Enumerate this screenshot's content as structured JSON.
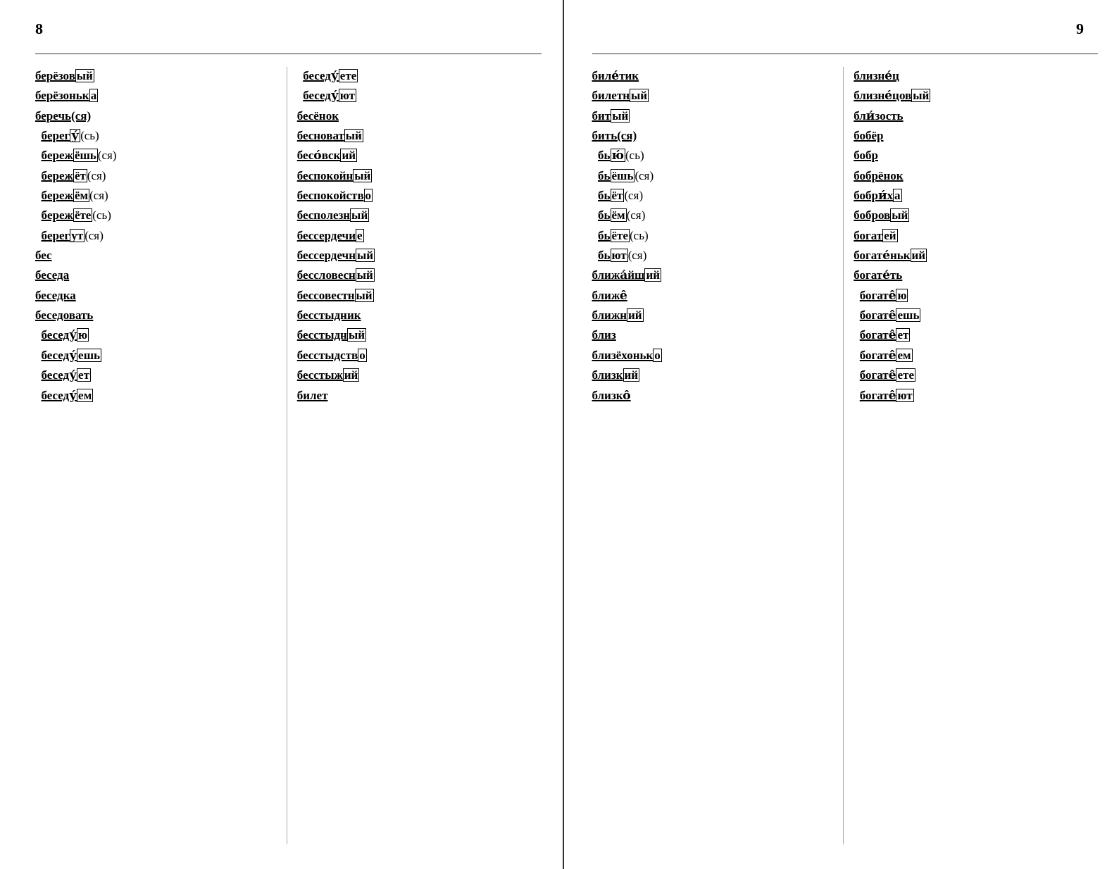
{
  "leftPage": {
    "number": "8",
    "col1": [
      {
        "html": "<span class='root'>берёзов</span><span class='box'>ый</span>"
      },
      {
        "html": "<span class='root'>берёзоньк</span><span class='box'>а</span>"
      },
      {
        "html": "<span class='root bold'>беречь(ся)</span>"
      },
      {
        "html": "&nbsp;&nbsp;<span class='root'>бeрег</span><span class='box'>у́</span>(сь)"
      },
      {
        "html": "&nbsp;&nbsp;<span class='root'>бeреж</span><span class='box'>ёшь</span>(ся)"
      },
      {
        "html": "&nbsp;&nbsp;<span class='root'>бeреж</span><span class='box'>ёт</span>(ся)"
      },
      {
        "html": "&nbsp;&nbsp;<span class='root'>бeреж</span><span class='box'>ём</span>(ся)"
      },
      {
        "html": "&nbsp;&nbsp;<span class='root'>бeреж</span><span class='box'>ёте</span>(сь)"
      },
      {
        "html": "&nbsp;&nbsp;<span class='root'>бeрег</span><span class='box'>ут</span>(ся)"
      },
      {
        "html": "<span class='root bold'>бес</span>"
      },
      {
        "html": "<span class='root bold'>беседа</span>"
      },
      {
        "html": "<span class='root bold'>беседка</span>"
      },
      {
        "html": "<span class='root bold'>беседовать</span>"
      },
      {
        "html": "&nbsp;&nbsp;<span class='root'>беседу́</span><span class='box'>ю</span>"
      },
      {
        "html": "&nbsp;&nbsp;<span class='root'>беседу́</span><span class='box'>ешь</span>"
      },
      {
        "html": "&nbsp;&nbsp;<span class='root'>беседу́</span><span class='box'>ет</span>"
      },
      {
        "html": "&nbsp;&nbsp;<span class='root'>беседу́</span><span class='box'>ем</span>"
      }
    ],
    "col2": [
      {
        "html": "&nbsp;&nbsp;<span class='root'>беседу́</span><span class='box'>ете</span>"
      },
      {
        "html": "&nbsp;&nbsp;<span class='root'>беседу́</span><span class='box'>ют</span>"
      },
      {
        "html": "<span class='root bold'>бесёнок</span>"
      },
      {
        "html": "<span class='root bold'>бесноват</span><span class='box'>ый</span>"
      },
      {
        "html": "<span class='root bold'>бесо́вск</span><span class='box'>ий</span>"
      },
      {
        "html": "<span class='root bold'>беспокойн</span><span class='box'>ый</span>"
      },
      {
        "html": "<span class='root bold'>беспокойств</span><span class='box'>о</span>"
      },
      {
        "html": "<span class='root bold'>бесполезн</span><span class='box'>ый</span>"
      },
      {
        "html": "<span class='root bold'>бессердечи</span><span class='box'>е</span>"
      },
      {
        "html": "<span class='root bold'>бессердечн</span><span class='box'>ый</span>"
      },
      {
        "html": "<span class='root bold'>бессловесн</span><span class='box'>ый</span>"
      },
      {
        "html": "<span class='root bold'>бессовестн</span><span class='box'>ый</span>"
      },
      {
        "html": "<span class='root bold'>бесстыдник</span>"
      },
      {
        "html": "<span class='root bold'>бесстыдн</span><span class='box'>ый</span>"
      },
      {
        "html": "<span class='root bold'>бесстыдств</span><span class='box'>о</span>"
      },
      {
        "html": "<span class='root bold'>бесстыж</span><span class='box'>ий</span>"
      },
      {
        "html": "<span class='root bold'>билет</span>"
      }
    ]
  },
  "rightPage": {
    "number": "9",
    "col1": [
      {
        "html": "<span class='root bold'>биле́тик</span>"
      },
      {
        "html": "<span class='root bold'>билетн</span><span class='box'>ый</span>"
      },
      {
        "html": "<span class='root bold'>бит</span><span class='box'>ый</span>"
      },
      {
        "html": "<span class='root bold'>бить(ся)</span>"
      },
      {
        "html": "&nbsp;&nbsp;<span class='root'>бь</span><span class='box'>ю́</span>(сь)"
      },
      {
        "html": "&nbsp;&nbsp;<span class='root'>бь</span><span class='box'>ёшь</span>(ся)"
      },
      {
        "html": "&nbsp;&nbsp;<span class='root'>бь</span><span class='box'>ёт</span>(ся)"
      },
      {
        "html": "&nbsp;&nbsp;<span class='root'>бь</span><span class='box'>ём</span>(ся)"
      },
      {
        "html": "&nbsp;&nbsp;<span class='root'>бь</span><span class='box'>ёте</span>(сь)"
      },
      {
        "html": "&nbsp;&nbsp;<span class='root'>бь</span><span class='box'>ют</span>(ся)"
      },
      {
        "html": "<span class='root bold'>ближа́йш</span><span class='box'>ий</span>"
      },
      {
        "html": "<span class='root bold'>ближе̂</span>"
      },
      {
        "html": "<span class='root bold'>ближн</span><span class='box'>ий</span>"
      },
      {
        "html": "<span class='root bold'>близ</span>"
      },
      {
        "html": "<span class='root bold'>близёхоньк</span><span class='box'>о</span>"
      },
      {
        "html": "<span class='root bold'>близк</span><span class='box'>ий</span>"
      },
      {
        "html": "<span class='root bold'>близко̂</span>"
      }
    ],
    "col2": [
      {
        "html": "<span class='root bold'>близне́ц</span>"
      },
      {
        "html": "<span class='root bold'>близне́цов</span><span class='box'>ый</span>"
      },
      {
        "html": "<span class='root bold'>бли́зость</span>"
      },
      {
        "html": "<span class='root bold'>бобёр</span>"
      },
      {
        "html": "<span class='root bold'>бобр</span>"
      },
      {
        "html": "<span class='root bold'>бобрёнок</span>"
      },
      {
        "html": "<span class='root bold'>бобри́х</span><span class='box'>а</span>"
      },
      {
        "html": "<span class='root bold'>бобров</span><span class='box'>ый</span>"
      },
      {
        "html": "<span class='root bold'>богат</span><span class='box'>ей</span>"
      },
      {
        "html": "<span class='root bold'>богате́ньк</span><span class='box'>ий</span>"
      },
      {
        "html": "<span class='root bold'>богате́ть</span>"
      },
      {
        "html": "&nbsp;&nbsp;<span class='root'>богате̂</span><span class='box'>ю</span>"
      },
      {
        "html": "&nbsp;&nbsp;<span class='root'>богате̂</span><span class='box'>ешь</span>"
      },
      {
        "html": "&nbsp;&nbsp;<span class='root'>богате̂</span><span class='box'>ет</span>"
      },
      {
        "html": "&nbsp;&nbsp;<span class='root'>богате̂</span><span class='box'>ем</span>"
      },
      {
        "html": "&nbsp;&nbsp;<span class='root'>богате̂</span><span class='box'>ете</span>"
      },
      {
        "html": "&nbsp;&nbsp;<span class='root'>богате̂</span><span class='box'>ют</span>"
      }
    ]
  }
}
